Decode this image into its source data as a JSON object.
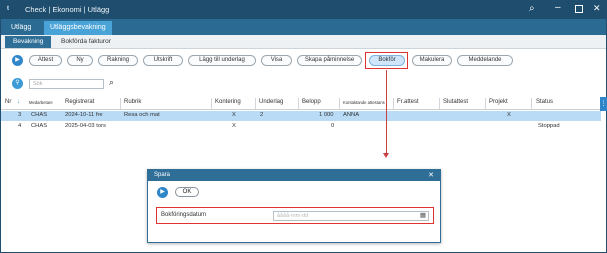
{
  "window": {
    "title": "Check | Ekonomi | Utlägg"
  },
  "tabs": [
    {
      "label": "Utlägg"
    },
    {
      "label": "Utläggsbevakning"
    }
  ],
  "subtabs": [
    {
      "label": "Bevakning"
    },
    {
      "label": "Bokförda fakturor"
    }
  ],
  "toolbar": {
    "buttons": [
      "Attest",
      "Ny",
      "Rakning",
      "Utskrift",
      "Lägg till underlag",
      "Visa",
      "Skapa påminnelse",
      "Bokför",
      "Makulera",
      "Meddelande"
    ]
  },
  "filter": {
    "placeholder": "Sök"
  },
  "grid": {
    "columns": [
      "Nr",
      "↓",
      "Medarbetare",
      "Registrerat",
      "Rubrik",
      "Kontering",
      "Underlag",
      "Belopp",
      "Kontaktande attestans",
      "Fr.attest",
      "Slutattest",
      "Projekt",
      "Status"
    ],
    "rows": [
      {
        "nr": "3",
        "med": "CHAS",
        "reg": "2024-10-11 fre",
        "rubrik": "Resa och mat",
        "kont": "X",
        "underlag": "2",
        "belopp": "1 000",
        "kontakt": "ANNA",
        "frattest": "",
        "slut": "",
        "projekt": "X",
        "status": "",
        "selected": true
      },
      {
        "nr": "4",
        "med": "CHAS",
        "reg": "2025-04-03 tors",
        "rubrik": "",
        "kont": "X",
        "underlag": "",
        "belopp": "0",
        "kontakt": "",
        "frattest": "",
        "slut": "",
        "projekt": "",
        "status": "Stoppad",
        "selected": false
      }
    ]
  },
  "dialog": {
    "title": "Spara",
    "ok_label": "OK",
    "field_label": "Bokföringsdatum",
    "field_placeholder": "åååå-mm-dd"
  },
  "colors": {
    "titlebar": "#1e4d6e",
    "accent": "#2f86c9",
    "selected_row": "#b9dbf6",
    "highlight": "#dd3333"
  }
}
